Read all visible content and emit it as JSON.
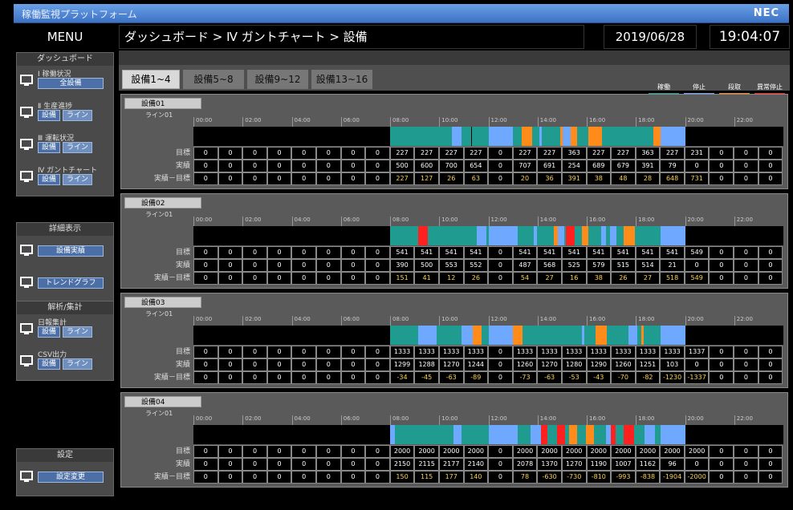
{
  "window": {
    "title": "稼働監視プラットフォーム",
    "brand": "NEC"
  },
  "header": {
    "menu": "MENU",
    "breadcrumb": "ダッシュボード > Ⅳ ガントチャート > 設備",
    "date": "2019/06/28",
    "time": "19:04:07"
  },
  "sidebar": {
    "dashboard": {
      "title": "ダッシュボード",
      "items": [
        {
          "label": "Ⅰ 稼働状況",
          "icon": "bar-chart-icon",
          "buttons": [
            "全設備"
          ]
        },
        {
          "label": "Ⅱ 生産進捗",
          "icon": "monitor-icon",
          "buttons": [
            "設備",
            "ライン"
          ]
        },
        {
          "label": "Ⅲ 運転状況",
          "icon": "monitor-icon",
          "buttons": [
            "設備",
            "ライン"
          ]
        },
        {
          "label": "Ⅳ ガントチャート",
          "icon": "gantt-icon",
          "buttons": [
            "設備",
            "ライン"
          ]
        }
      ]
    },
    "detail": {
      "title": "詳細表示",
      "items": [
        {
          "label": "",
          "icon": "factory-icon",
          "buttons": [
            "設備実績"
          ]
        },
        {
          "label": "",
          "icon": "trend-icon",
          "buttons": [
            "トレンドグラフ"
          ]
        }
      ]
    },
    "analysis": {
      "title": "解析/集計",
      "items": [
        {
          "label": "日報集計",
          "icon": "report-icon",
          "buttons": [
            "設備",
            "ライン"
          ]
        },
        {
          "label": "CSV出力",
          "icon": "csv-icon",
          "buttons": [
            "設備",
            "ライン"
          ]
        }
      ]
    },
    "settings": {
      "title": "設定",
      "items": [
        {
          "label": "",
          "icon": "tools-icon",
          "buttons": [
            "設定変更"
          ]
        }
      ]
    }
  },
  "tabs": [
    "設備1~4",
    "設備5~8",
    "設備9~12",
    "設備13~16"
  ],
  "legend": [
    {
      "label": "稼働",
      "color": "#1f9b8f"
    },
    {
      "label": "停止",
      "color": "#6fa8ff"
    },
    {
      "label": "段取",
      "color": "#ff8c1a"
    },
    {
      "label": "異常停止",
      "color": "#ff2020"
    }
  ],
  "hours": [
    "00:00",
    "02:00",
    "04:00",
    "06:00",
    "08:00",
    "10:00",
    "12:00",
    "14:00",
    "16:00",
    "18:00",
    "20:00",
    "22:00"
  ],
  "rowlabels": [
    "目標",
    "実績",
    "実績－目標"
  ],
  "equipment": [
    {
      "name": "設備01",
      "line": "ライン01",
      "target": [
        "0",
        "0",
        "0",
        "0",
        "0",
        "0",
        "0",
        "0",
        "227",
        "227",
        "227",
        "227",
        "0",
        "227",
        "227",
        "363",
        "227",
        "227",
        "363",
        "227",
        "231",
        "0",
        "0",
        "0"
      ],
      "actual": [
        "0",
        "0",
        "0",
        "0",
        "0",
        "0",
        "0",
        "0",
        "500",
        "600",
        "700",
        "654",
        "0",
        "707",
        "691",
        "254",
        "689",
        "679",
        "391",
        "79",
        "0",
        "0",
        "0",
        "0"
      ],
      "diff": [
        "0",
        "0",
        "0",
        "0",
        "0",
        "0",
        "0",
        "0",
        "227",
        "127",
        "26",
        "63",
        "0",
        "20",
        "36",
        "391",
        "38",
        "48",
        "28",
        "648",
        "731",
        "0",
        "0",
        "0"
      ]
    },
    {
      "name": "設備02",
      "line": "ライン01",
      "target": [
        "0",
        "0",
        "0",
        "0",
        "0",
        "0",
        "0",
        "0",
        "541",
        "541",
        "541",
        "541",
        "0",
        "541",
        "541",
        "541",
        "541",
        "541",
        "541",
        "541",
        "549",
        "0",
        "0",
        "0"
      ],
      "actual": [
        "0",
        "0",
        "0",
        "0",
        "0",
        "0",
        "0",
        "0",
        "390",
        "500",
        "553",
        "552",
        "0",
        "487",
        "568",
        "525",
        "579",
        "515",
        "514",
        "21",
        "0",
        "0",
        "0",
        "0"
      ],
      "diff": [
        "0",
        "0",
        "0",
        "0",
        "0",
        "0",
        "0",
        "0",
        "151",
        "41",
        "12",
        "26",
        "0",
        "54",
        "27",
        "16",
        "38",
        "26",
        "27",
        "518",
        "549",
        "0",
        "0",
        "0"
      ]
    },
    {
      "name": "設備03",
      "line": "ライン01",
      "target": [
        "0",
        "0",
        "0",
        "0",
        "0",
        "0",
        "0",
        "0",
        "1333",
        "1333",
        "1333",
        "1333",
        "0",
        "1333",
        "1333",
        "1333",
        "1333",
        "1333",
        "1333",
        "1333",
        "1337",
        "0",
        "0",
        "0"
      ],
      "actual": [
        "0",
        "0",
        "0",
        "0",
        "0",
        "0",
        "0",
        "0",
        "1299",
        "1288",
        "1270",
        "1244",
        "0",
        "1260",
        "1270",
        "1280",
        "1290",
        "1260",
        "1251",
        "103",
        "0",
        "0",
        "0",
        "0"
      ],
      "diff": [
        "0",
        "0",
        "0",
        "0",
        "0",
        "0",
        "0",
        "0",
        "-34",
        "-45",
        "-63",
        "-89",
        "0",
        "-73",
        "-63",
        "-53",
        "-43",
        "-70",
        "-82",
        "-1230",
        "-1337",
        "0",
        "0",
        "0"
      ]
    },
    {
      "name": "設備04",
      "line": "ライン01",
      "target": [
        "0",
        "0",
        "0",
        "0",
        "0",
        "0",
        "0",
        "0",
        "2000",
        "2000",
        "2000",
        "2000",
        "0",
        "2000",
        "2000",
        "2000",
        "2000",
        "2000",
        "2000",
        "2000",
        "2000",
        "0",
        "0",
        "0"
      ],
      "actual": [
        "0",
        "0",
        "0",
        "0",
        "0",
        "0",
        "0",
        "0",
        "2150",
        "2115",
        "2177",
        "2140",
        "0",
        "2078",
        "1370",
        "1270",
        "1190",
        "1007",
        "1162",
        "96",
        "0",
        "0",
        "0",
        "0"
      ],
      "diff": [
        "0",
        "0",
        "0",
        "0",
        "0",
        "0",
        "0",
        "0",
        "150",
        "115",
        "177",
        "140",
        "0",
        "78",
        "-630",
        "-730",
        "-810",
        "-993",
        "-838",
        "-1904",
        "-2000",
        "0",
        "0",
        "0"
      ]
    }
  ]
}
